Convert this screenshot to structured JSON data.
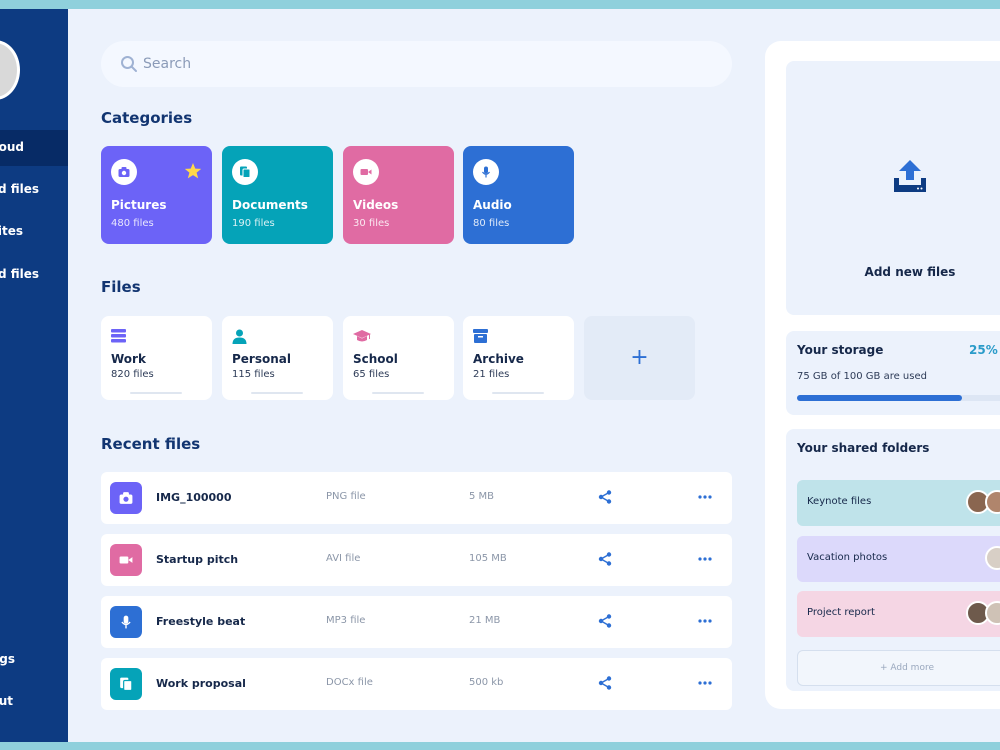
{
  "sidebar": {
    "items": [
      {
        "label": "oud"
      },
      {
        "label": "d files"
      },
      {
        "label": "ites"
      },
      {
        "label": "d files"
      },
      {
        "label": "gs"
      },
      {
        "label": "ut"
      }
    ]
  },
  "search": {
    "placeholder": "Search",
    "icon": "search-icon"
  },
  "categories": {
    "title": "Categories",
    "items": [
      {
        "name": "Pictures",
        "count": "480 files",
        "color": "#6c63f7",
        "icon": "camera-icon",
        "starred": true
      },
      {
        "name": "Documents",
        "count": "190 files",
        "color": "#05a3b8",
        "icon": "document-icon"
      },
      {
        "name": "Videos",
        "count": "30 files",
        "color": "#e06ba3",
        "icon": "video-icon"
      },
      {
        "name": "Audio",
        "count": "80 files",
        "color": "#2d6fd4",
        "icon": "microphone-icon"
      }
    ]
  },
  "files": {
    "title": "Files",
    "items": [
      {
        "name": "Work",
        "count": "820 files",
        "icon": "stack-icon",
        "color": "#6c63f7"
      },
      {
        "name": "Personal",
        "count": "115 files",
        "icon": "person-icon",
        "color": "#05a3b8"
      },
      {
        "name": "School",
        "count": "65 files",
        "icon": "graduation-cap-icon",
        "color": "#e06ba3"
      },
      {
        "name": "Archive",
        "count": "21 files",
        "icon": "archive-box-icon",
        "color": "#2d6fd4"
      }
    ],
    "add_label": "+"
  },
  "recent": {
    "title": "Recent files",
    "rows": [
      {
        "name": "IMG_100000",
        "type": "PNG file",
        "size": "5 MB",
        "color": "#6c63f7",
        "icon": "camera-icon"
      },
      {
        "name": "Startup pitch",
        "type": "AVI file",
        "size": "105 MB",
        "color": "#e06ba3",
        "icon": "video-icon"
      },
      {
        "name": "Freestyle beat",
        "type": "MP3 file",
        "size": "21 MB",
        "color": "#2d6fd4",
        "icon": "microphone-icon"
      },
      {
        "name": "Work proposal",
        "type": "DOCx file",
        "size": "500 kb",
        "color": "#05a3b8",
        "icon": "document-icon"
      }
    ]
  },
  "upload": {
    "label": "Add new files",
    "icon": "upload-icon"
  },
  "storage": {
    "title": "Your storage",
    "percent": "25%",
    "usage": "75 GB of 100 GB are used",
    "fill_fraction": 0.75
  },
  "shared": {
    "title": "Your shared folders",
    "folders": [
      {
        "name": "Keynote files",
        "color": "#bfe3ea"
      },
      {
        "name": "Vacation photos",
        "color": "#dcd9fb"
      },
      {
        "name": "Project report",
        "color": "#f5d6e4"
      }
    ],
    "add_more": "+ Add more"
  }
}
